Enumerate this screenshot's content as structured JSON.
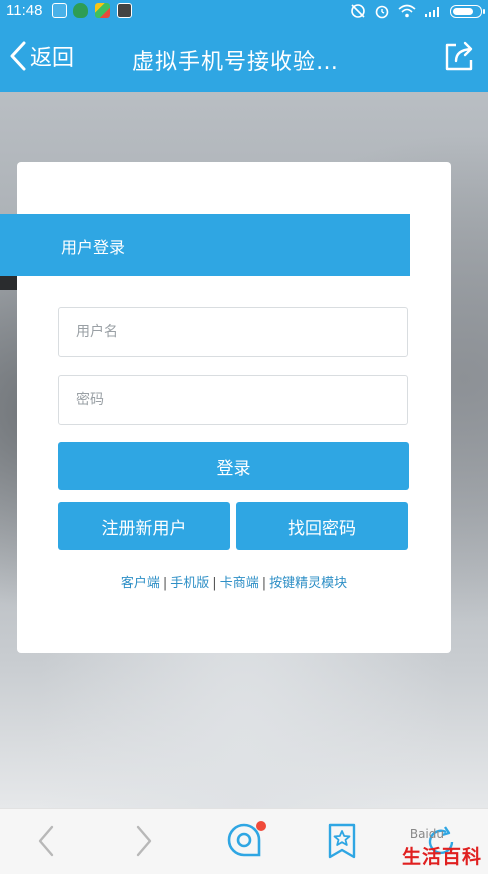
{
  "status_bar": {
    "time": "11:48",
    "battery_level": 0.85
  },
  "nav": {
    "back_label": "返回",
    "title": "虚拟手机号接收验…"
  },
  "login": {
    "header": "用户登录",
    "username_placeholder": "用户名",
    "password_placeholder": "密码",
    "login_button": "登录",
    "register_button": "注册新用户",
    "recover_button": "找回密码",
    "links": [
      "客户端",
      "手机版",
      "卡商端",
      "按键精灵模块"
    ],
    "separator": "|"
  },
  "toolbar": {
    "items": [
      "back-arrow-icon",
      "forward-arrow-icon",
      "tab-bubble-icon",
      "bookmark-star-icon",
      "refresh-icon"
    ]
  },
  "watermark": {
    "text": "生活百科",
    "small_text": "Baidu"
  },
  "colors": {
    "accent": "#2fa6e3",
    "link": "#2e8fc6",
    "badge": "#f04a3a",
    "watermark": "#e02020"
  }
}
